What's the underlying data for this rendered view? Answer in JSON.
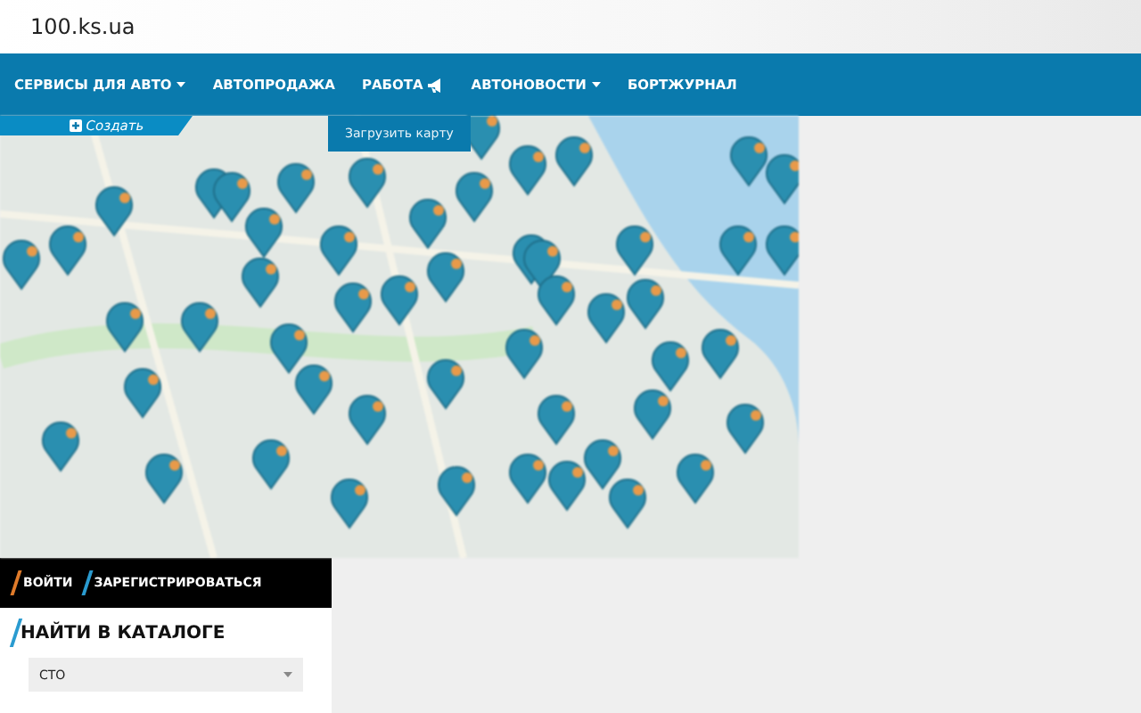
{
  "site_title": "100.ks.ua",
  "nav": [
    {
      "label": "СЕРВИСЫ ДЛЯ АВТО",
      "kind": "dropdown"
    },
    {
      "label": "АВТОПРОДАЖА",
      "kind": "plain"
    },
    {
      "label": "РАБОТА",
      "kind": "megaphone"
    },
    {
      "label": "АВТОНОВОСТИ",
      "kind": "dropdown"
    },
    {
      "label": "БОРТЖУРНАЛ",
      "kind": "plain"
    }
  ],
  "create_tab": {
    "label": "Создать"
  },
  "upload_map_button": {
    "label": "Загрузить карту"
  },
  "auth": {
    "login": "ВОЙТИ",
    "register": "ЗАРЕГИСТРИРОВАТЬСЯ"
  },
  "catalog": {
    "title": "НАЙТИ В КАТАЛОГЕ",
    "select": {
      "value": "СТО"
    }
  }
}
